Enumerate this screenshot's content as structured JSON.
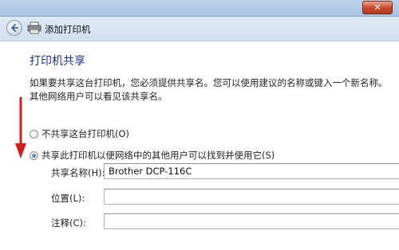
{
  "window": {
    "close_glyph": "✕"
  },
  "header": {
    "title": "添加打印机"
  },
  "page": {
    "title": "打印机共享",
    "description": "如果要共享这台打印机，您必须提供共享名。您可以使用建议的名称或键入一个新名称。其他网络用户可以看见该共享名。"
  },
  "options": {
    "no_share_label": "不共享这台打印机(O)",
    "share_label": "共享此打印机以便网络中的其他用户可以找到并使用它(S)",
    "selected": "share"
  },
  "form": {
    "share_name_label": "共享名称(H):",
    "share_name_value": "Brother DCP-116C",
    "location_label": "位置(L):",
    "location_value": "",
    "comment_label": "注释(C):",
    "comment_value": ""
  },
  "colors": {
    "title_blue": "#1e3287",
    "arrow_red": "#d21b1b"
  }
}
